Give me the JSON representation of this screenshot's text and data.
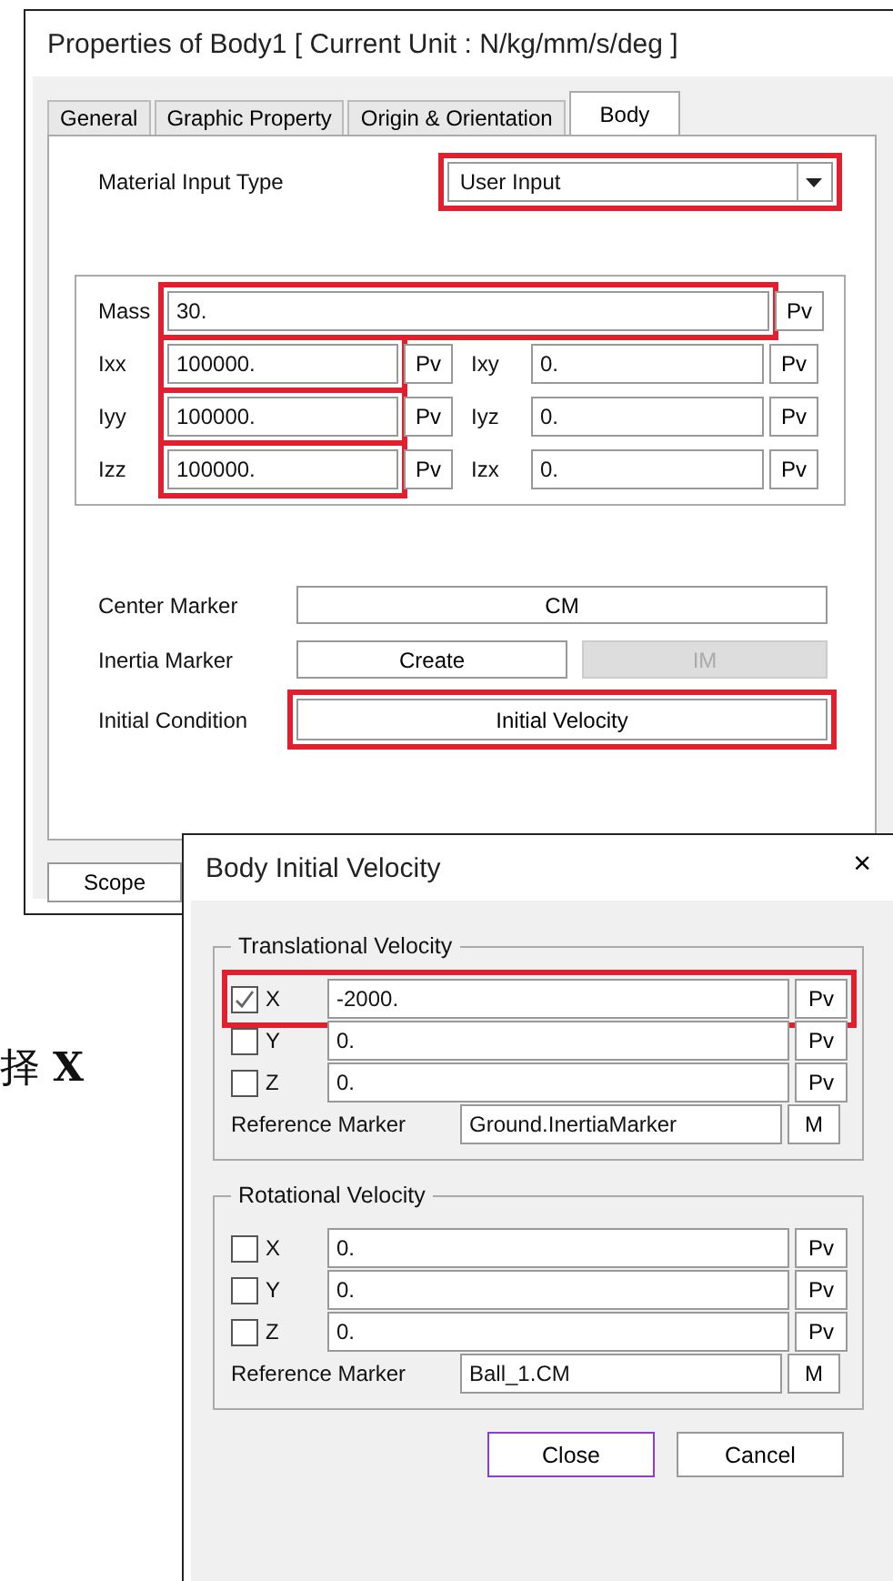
{
  "background_text": "择 **X**",
  "properties_dialog": {
    "title": "Properties of Body1 [ Current Unit : N/kg/mm/s/deg ]",
    "tabs": [
      {
        "label": "General",
        "selected": false
      },
      {
        "label": "Graphic Property",
        "selected": false
      },
      {
        "label": "Origin & Orientation",
        "selected": false
      },
      {
        "label": "Body",
        "selected": true
      }
    ],
    "material_input_type": {
      "label": "Material Input Type",
      "value": "User Input",
      "highlighted": true
    },
    "mass": {
      "label": "Mass",
      "value": "30.",
      "button": "Pv",
      "highlighted": true
    },
    "inertia": [
      {
        "label": "Ixx",
        "value": "100000.",
        "button": "Pv",
        "highlighted": true
      },
      {
        "label": "Ixy",
        "value": "0.",
        "button": "Pv"
      },
      {
        "label": "Iyy",
        "value": "100000.",
        "button": "Pv",
        "highlighted": true
      },
      {
        "label": "Iyz",
        "value": "0.",
        "button": "Pv"
      },
      {
        "label": "Izz",
        "value": "100000.",
        "button": "Pv",
        "highlighted": true
      },
      {
        "label": "Izx",
        "value": "0.",
        "button": "Pv"
      }
    ],
    "center_marker": {
      "label": "Center Marker",
      "button": "CM"
    },
    "inertia_marker": {
      "label": "Inertia Marker",
      "buttons": [
        {
          "label": "Create",
          "disabled": false
        },
        {
          "label": "IM",
          "disabled": true
        }
      ]
    },
    "initial_condition": {
      "label": "Initial Condition",
      "button": "Initial Velocity",
      "highlighted": true
    },
    "bottom_buttons": [
      "Scope"
    ]
  },
  "velocity_dialog": {
    "title": "Body Initial Velocity",
    "close": "×",
    "groups": [
      {
        "title": "Translational Velocity",
        "rows": [
          {
            "label": "X",
            "checked": true,
            "value": "-2000.",
            "button": "Pv",
            "highlighted": true
          },
          {
            "label": "Y",
            "checked": false,
            "value": "0.",
            "button": "Pv"
          },
          {
            "label": "Z",
            "checked": false,
            "value": "0.",
            "button": "Pv"
          }
        ],
        "reference_marker": {
          "label": "Reference Marker",
          "value": "Ground.InertiaMarker",
          "button": "M"
        }
      },
      {
        "title": "Rotational Velocity",
        "rows": [
          {
            "label": "X",
            "checked": false,
            "value": "0.",
            "button": "Pv"
          },
          {
            "label": "Y",
            "checked": false,
            "value": "0.",
            "button": "Pv"
          },
          {
            "label": "Z",
            "checked": false,
            "value": "0.",
            "button": "Pv"
          }
        ],
        "reference_marker": {
          "label": "Reference Marker",
          "value": "Ball_1.CM",
          "button": "M"
        }
      }
    ],
    "buttons": [
      {
        "label": "Close",
        "focused": true
      },
      {
        "label": "Cancel",
        "focused": false
      }
    ]
  }
}
